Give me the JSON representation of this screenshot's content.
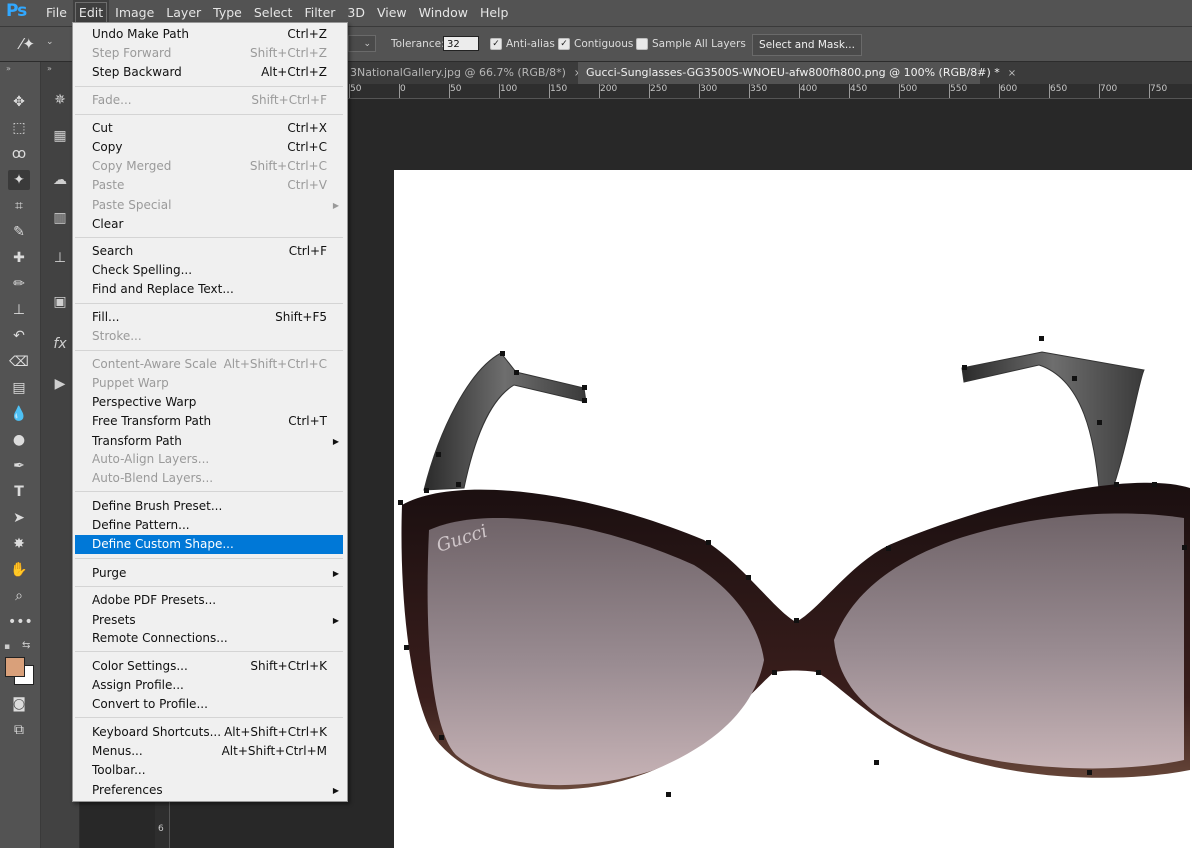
{
  "app": {
    "logo": "Ps"
  },
  "menubar": {
    "items": [
      "File",
      "Edit",
      "Image",
      "Layer",
      "Type",
      "Select",
      "Filter",
      "3D",
      "View",
      "Window",
      "Help"
    ],
    "active": "Edit"
  },
  "options": {
    "tolerance_label": "Tolerance:",
    "tolerance_value": "32",
    "anti_alias": "Anti-alias",
    "contiguous": "Contiguous",
    "sample_all_layers": "Sample All Layers",
    "select_mask_button": "Select and Mask..."
  },
  "tabs": [
    {
      "label": "3NationalGallery.jpg @ 66.7% (RGB/8*)",
      "close": "×"
    },
    {
      "label": "Gucci-Sunglasses-GG3500S-WNOEU-afw800fh800.png @ 100% (RGB/8#) *",
      "close": "×"
    }
  ],
  "ruler": {
    "h_labels": [
      "50",
      "0",
      "50",
      "100",
      "150",
      "200",
      "250",
      "300",
      "350",
      "400",
      "450",
      "500",
      "550",
      "600",
      "650",
      "700",
      "750"
    ],
    "v_label": "6"
  },
  "edit_menu": {
    "items": [
      {
        "label": "Undo Make Path",
        "shortcut": "Ctrl+Z",
        "state": "enabled"
      },
      {
        "label": "Step Forward",
        "shortcut": "Shift+Ctrl+Z",
        "state": "disabled"
      },
      {
        "label": "Step Backward",
        "shortcut": "Alt+Ctrl+Z",
        "state": "enabled"
      },
      {
        "label": "Fade...",
        "shortcut": "Shift+Ctrl+F",
        "state": "disabled"
      },
      {
        "label": "Cut",
        "shortcut": "Ctrl+X",
        "state": "enabled"
      },
      {
        "label": "Copy",
        "shortcut": "Ctrl+C",
        "state": "enabled"
      },
      {
        "label": "Copy Merged",
        "shortcut": "Shift+Ctrl+C",
        "state": "disabled"
      },
      {
        "label": "Paste",
        "shortcut": "Ctrl+V",
        "state": "disabled"
      },
      {
        "label": "Paste Special",
        "shortcut": "",
        "state": "disabled"
      },
      {
        "label": "Clear",
        "shortcut": "",
        "state": "enabled"
      },
      {
        "label": "Search",
        "shortcut": "Ctrl+F",
        "state": "enabled"
      },
      {
        "label": "Check Spelling...",
        "shortcut": "",
        "state": "enabled"
      },
      {
        "label": "Find and Replace Text...",
        "shortcut": "",
        "state": "enabled"
      },
      {
        "label": "Fill...",
        "shortcut": "Shift+F5",
        "state": "enabled"
      },
      {
        "label": "Stroke...",
        "shortcut": "",
        "state": "disabled"
      },
      {
        "label": "Content-Aware Scale",
        "shortcut": "Alt+Shift+Ctrl+C",
        "state": "disabled"
      },
      {
        "label": "Puppet Warp",
        "shortcut": "",
        "state": "disabled"
      },
      {
        "label": "Perspective Warp",
        "shortcut": "",
        "state": "enabled"
      },
      {
        "label": "Free Transform Path",
        "shortcut": "Ctrl+T",
        "state": "enabled"
      },
      {
        "label": "Transform Path",
        "shortcut": "",
        "state": "enabled"
      },
      {
        "label": "Auto-Align Layers...",
        "shortcut": "",
        "state": "disabled"
      },
      {
        "label": "Auto-Blend Layers...",
        "shortcut": "",
        "state": "disabled"
      },
      {
        "label": "Define Brush Preset...",
        "shortcut": "",
        "state": "enabled"
      },
      {
        "label": "Define Pattern...",
        "shortcut": "",
        "state": "enabled"
      },
      {
        "label": "Define Custom Shape...",
        "shortcut": "",
        "state": "highlighted"
      },
      {
        "label": "Purge",
        "shortcut": "",
        "state": "enabled"
      },
      {
        "label": "Adobe PDF Presets...",
        "shortcut": "",
        "state": "enabled"
      },
      {
        "label": "Presets",
        "shortcut": "",
        "state": "enabled"
      },
      {
        "label": "Remote Connections...",
        "shortcut": "",
        "state": "enabled"
      },
      {
        "label": "Color Settings...",
        "shortcut": "Shift+Ctrl+K",
        "state": "enabled"
      },
      {
        "label": "Assign Profile...",
        "shortcut": "",
        "state": "enabled"
      },
      {
        "label": "Convert to Profile...",
        "shortcut": "",
        "state": "enabled"
      },
      {
        "label": "Keyboard Shortcuts...",
        "shortcut": "Alt+Shift+Ctrl+K",
        "state": "enabled"
      },
      {
        "label": "Menus...",
        "shortcut": "Alt+Shift+Ctrl+M",
        "state": "enabled"
      },
      {
        "label": "Toolbar...",
        "shortcut": "",
        "state": "enabled"
      },
      {
        "label": "Preferences",
        "shortcut": "",
        "state": "enabled"
      }
    ]
  },
  "colors": {
    "accent": "#0078d7",
    "foreground_swatch": "#d9a07a",
    "background_swatch": "#ffffff",
    "ps_blue": "#31a8ff"
  },
  "canvas": {
    "image_logo_text": "Gucci"
  }
}
